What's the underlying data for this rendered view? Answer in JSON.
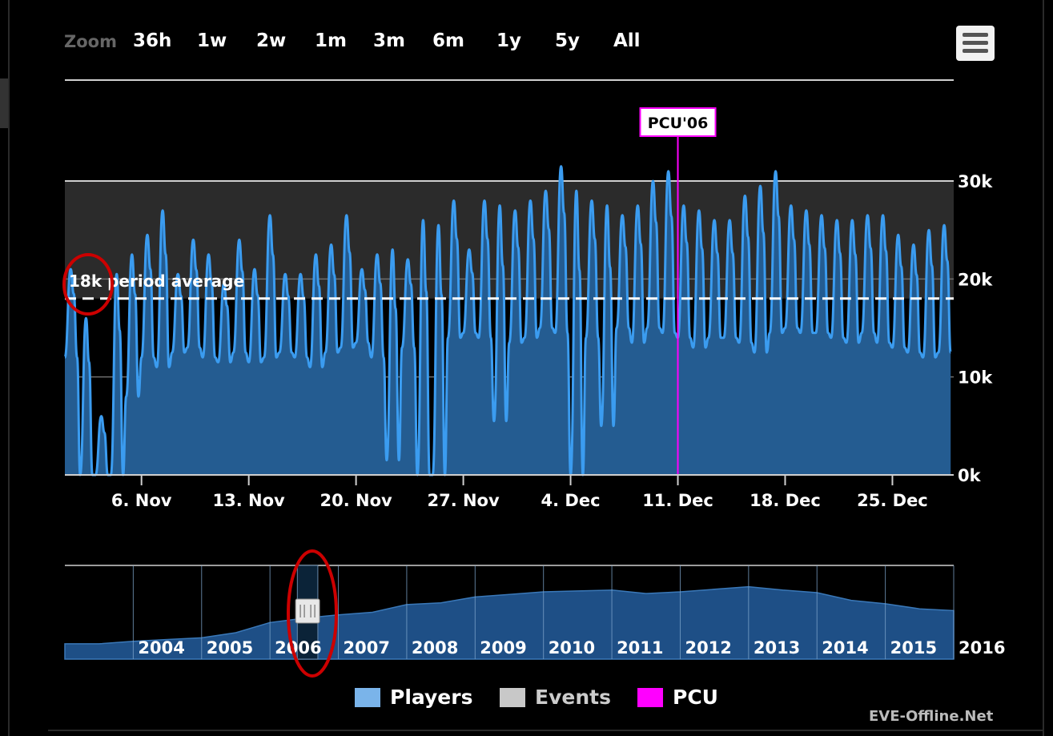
{
  "toolbar": {
    "zoom_label": "Zoom",
    "buttons": [
      "36h",
      "1w",
      "2w",
      "1m",
      "3m",
      "6m",
      "1y",
      "5y",
      "All"
    ]
  },
  "colors": {
    "background": "#000000",
    "players": "#3b9cf0",
    "players_fill": "#245c91",
    "events": "#c8c8c8",
    "pcu": "#ff00ff",
    "navigator_fill": "#1e4f86",
    "average_line": "#ffffff",
    "annotation_circle": "#cc0000"
  },
  "chart_data": {
    "type": "area",
    "ylabel": "",
    "ylim": [
      0,
      30000
    ],
    "yticks": [
      0,
      10000,
      20000,
      30000
    ],
    "ytick_labels": [
      "0k",
      "10k",
      "20k",
      "30k"
    ],
    "xlim": [
      1,
      59
    ],
    "xticks": [
      6,
      13,
      20,
      27,
      34,
      41,
      48,
      55
    ],
    "xtick_labels": [
      "6. Nov",
      "13. Nov",
      "20. Nov",
      "27. Nov",
      "4. Dec",
      "11. Dec",
      "18. Dec",
      "25. Dec"
    ],
    "series": [
      {
        "name": "Players",
        "daily_peaks": [
          21000,
          16000,
          6000,
          20500,
          22500,
          24500,
          27000,
          20500,
          24000,
          22500,
          19500,
          24000,
          21000,
          26500,
          20500,
          20500,
          22500,
          23500,
          26500,
          21000,
          22500,
          23000,
          22000,
          26000,
          25500,
          28000,
          23000,
          28000,
          27500,
          27000,
          28000,
          29000,
          31500,
          29000,
          28000,
          27500,
          26500,
          27500,
          30000,
          31000,
          27500,
          27000,
          26000,
          26000,
          28500,
          29500,
          31000,
          27500,
          27000,
          26500,
          26000,
          26000,
          26500,
          26500,
          24500,
          23500,
          25000,
          25500
        ],
        "daily_troughs": [
          12000,
          0,
          0,
          0,
          8000,
          12000,
          11000,
          12500,
          13000,
          12000,
          11500,
          12500,
          11500,
          12000,
          12500,
          12000,
          11000,
          12500,
          13000,
          13500,
          12000,
          1500,
          13000,
          0,
          0,
          14000,
          14500,
          14000,
          5500,
          13500,
          14000,
          15000,
          14500,
          0,
          14000,
          5000,
          15000,
          13500,
          15000,
          14500,
          14000,
          13000,
          14000,
          14000,
          13500,
          12500,
          14500,
          15000,
          14500,
          14500,
          14000,
          13500,
          14500,
          13500,
          13000,
          12500,
          12000,
          12500
        ],
        "average": 18000
      }
    ],
    "period_average_label": "18k period average",
    "pcu_flag": {
      "label": "PCU'06",
      "x": 41,
      "value": 32600
    },
    "navigator": {
      "xtick_labels": [
        "2004",
        "2005",
        "2006",
        "2007",
        "2008",
        "2009",
        "2010",
        "2011",
        "2012",
        "2013",
        "2014",
        "2015",
        "2016"
      ],
      "x": [
        2003.0,
        2003.5,
        2004.0,
        2004.5,
        2005.0,
        2005.5,
        2006.0,
        2006.5,
        2007.0,
        2007.5,
        2008.0,
        2008.5,
        2009.0,
        2009.5,
        2010.0,
        2010.5,
        2011.0,
        2011.5,
        2012.0,
        2012.5,
        2013.0,
        2013.5,
        2014.0,
        2014.5,
        2015.0,
        2015.5,
        2016.0
      ],
      "values": [
        9000,
        9000,
        10500,
        11500,
        12500,
        15500,
        21500,
        24000,
        26000,
        27500,
        32000,
        33000,
        36500,
        38000,
        39500,
        40000,
        40500,
        38500,
        39500,
        41000,
        42500,
        40500,
        39000,
        34500,
        32500,
        29500,
        28500
      ],
      "ylim": [
        0,
        55000
      ],
      "selected_range": [
        2006.4,
        2006.7
      ]
    }
  },
  "legend": [
    {
      "label": "Players"
    },
    {
      "label": "Events"
    },
    {
      "label": "PCU"
    }
  ],
  "credit": "EVE-Offline.Net"
}
